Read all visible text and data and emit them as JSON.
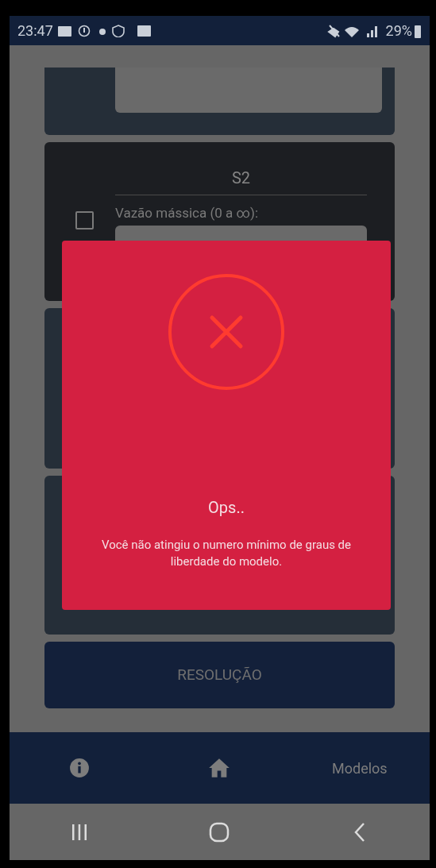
{
  "status_bar": {
    "time": "23:47",
    "battery": "29%"
  },
  "card": {
    "title": "S2",
    "field_label": "Vazão mássica (0 a ∞):",
    "checked": false
  },
  "resolve_button": "RESOLUÇÃO",
  "bottom_nav": [
    {
      "kind": "info"
    },
    {
      "kind": "home"
    },
    {
      "kind": "label",
      "label": "Modelos"
    }
  ],
  "dialog": {
    "title": "Ops..",
    "message": "Você não atingiu o numero mínimo de graus de liberdade do modelo."
  }
}
